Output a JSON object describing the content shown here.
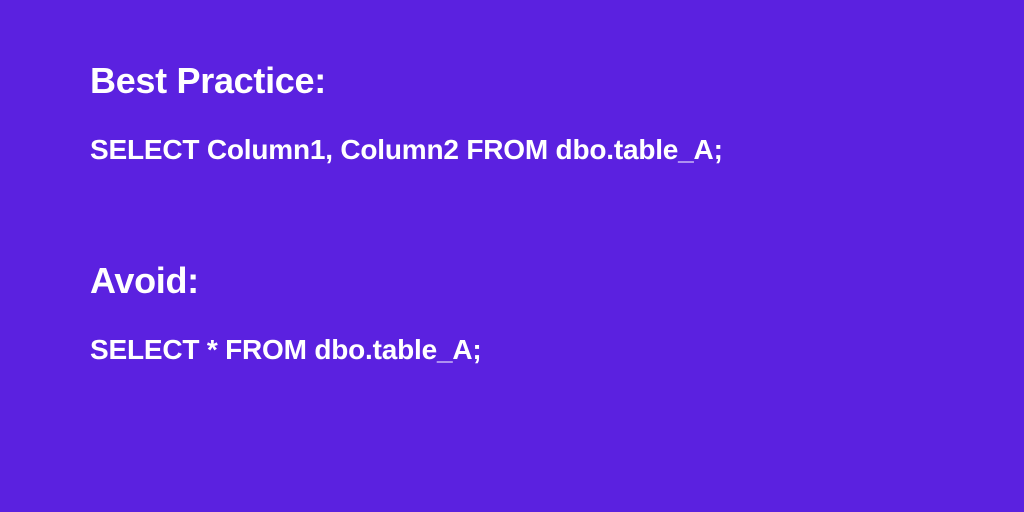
{
  "section1": {
    "heading": "Best Practice:",
    "code": "SELECT Column1, Column2 FROM dbo.table_A;"
  },
  "section2": {
    "heading": "Avoid:",
    "code": "SELECT  *  FROM dbo.table_A;"
  }
}
